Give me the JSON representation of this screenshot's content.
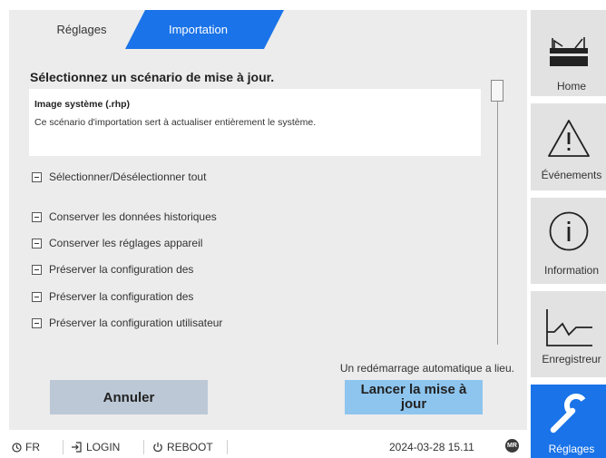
{
  "tabs": [
    {
      "label": "Réglages",
      "active": false
    },
    {
      "label": "Importation",
      "active": true
    }
  ],
  "panel": {
    "heading": "Sélectionnez un scénario de mise à jour.",
    "info_title": "Image système (.rhp)",
    "info_description": "Ce scénario d'importation sert à actualiser entièrement le système.",
    "select_all_label": "Sélectionner/Désélectionner tout",
    "options": [
      "Conserver les données historiques",
      "Conserver les réglages appareil",
      "Préserver la configuration des",
      "Préserver la configuration des",
      "Préserver la configuration utilisateur"
    ],
    "reboot_note": "Un redémarrage automatique a lieu.",
    "cancel_label": "Annuler",
    "start_label": "Lancer la mise à jour"
  },
  "status": {
    "language": "FR",
    "login": "LOGIN",
    "reboot": "REBOOT",
    "datetime": "2024-03-28 15.11",
    "badge": "MR"
  },
  "nav": [
    {
      "label": "Home",
      "icon": "home-icon"
    },
    {
      "label": "Événements",
      "icon": "warning-icon"
    },
    {
      "label": "Information",
      "icon": "info-icon"
    },
    {
      "label": "Enregistreur",
      "icon": "waveform-icon"
    },
    {
      "label": "Réglages",
      "icon": "wrench-icon",
      "active": true
    }
  ],
  "colors": {
    "accent": "#1a73e8",
    "panel_bg": "#ececec",
    "start_button": "#8ec5ee",
    "cancel_button": "#bcc8d6"
  }
}
